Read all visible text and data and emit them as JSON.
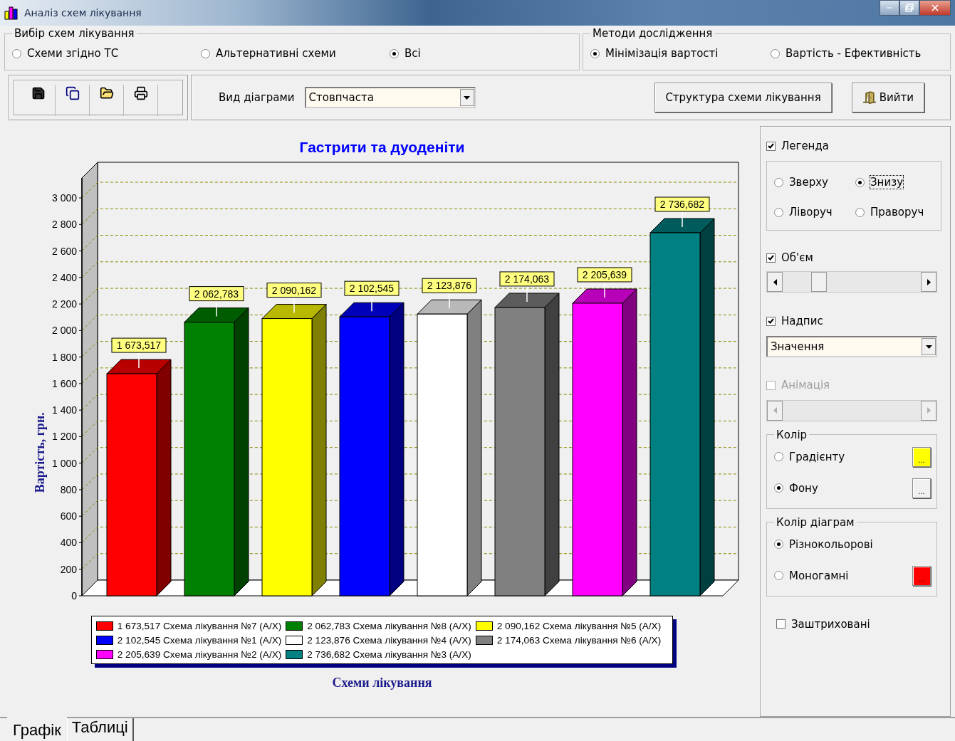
{
  "window": {
    "title": "Аналіз схем лікування"
  },
  "scheme_group": {
    "title": "Вибір схем лікування",
    "options": [
      {
        "label": "Схеми згідно ТС",
        "selected": false
      },
      {
        "label": "Альтернативні схеми",
        "selected": false
      },
      {
        "label": "Всі",
        "selected": true
      }
    ]
  },
  "method_group": {
    "title": "Методи дослідження",
    "options": [
      {
        "label": "Мінімізація вартості",
        "selected": true
      },
      {
        "label": "Вартість - Ефективність",
        "selected": false
      }
    ]
  },
  "toolbar": {
    "chart_type_label": "Вид діаграми",
    "chart_type_value": "Стовпчаста",
    "structure_button": "Структура схеми лікування",
    "exit_button": "Вийти"
  },
  "chart": {
    "chart_data": {
      "type": "bar",
      "title": "Гастрити та дуоденіти",
      "xlabel": "Схеми лікування",
      "ylabel": "Вартість, грн.",
      "series": [
        {
          "colors": [
            "#ff0000",
            "#008000",
            "#ffff00",
            "#0000ff",
            "#ffffff",
            "#808080",
            "#ff00ff",
            "#008080"
          ],
          "values": [
            1674,
            2063,
            2090,
            2103,
            2124,
            2174,
            2206,
            2737
          ]
        }
      ],
      "ylim": [
        0,
        3000
      ],
      "yticks": [
        {
          "value": 0,
          "label": "0"
        },
        {
          "value": 200,
          "label": "200"
        },
        {
          "value": 400,
          "label": "400"
        },
        {
          "value": 600,
          "label": "600"
        },
        {
          "value": 800,
          "label": "800"
        },
        {
          "value": 1000,
          "label": "1 000"
        },
        {
          "value": 1200,
          "label": "1 200"
        },
        {
          "value": 1400,
          "label": "1 400"
        },
        {
          "value": 1600,
          "label": "1 600"
        },
        {
          "value": 1800,
          "label": "1 800"
        },
        {
          "value": 2000,
          "label": "2 000"
        },
        {
          "value": 2200,
          "label": "2 200"
        },
        {
          "value": 2400,
          "label": "2 400"
        },
        {
          "value": 2600,
          "label": "2 600"
        },
        {
          "value": 2800,
          "label": "2 800"
        },
        {
          "value": 3000,
          "label": "3 000"
        }
      ],
      "value_labels": [
        "1 673,517",
        "2 062,783",
        "2 090,162",
        "2 102,545",
        "2 123,876",
        "2 174,063",
        "2 205,639",
        "2 736,682"
      ]
    },
    "legend": [
      {
        "value": "1 673,517",
        "name": "Схема лікування №7 (А/Х)",
        "color": "#ff0000"
      },
      {
        "value": "2 062,783",
        "name": "Схема лікування №8 (А/Х)",
        "color": "#008000"
      },
      {
        "value": "2 090,162",
        "name": "Схема лікування №5 (А/Х)",
        "color": "#ffff00"
      },
      {
        "value": "2 102,545",
        "name": "Схема лікування №1 (А/Х)",
        "color": "#0000ff"
      },
      {
        "value": "2 123,876",
        "name": "Схема лікування №4 (А/Х)",
        "color": "#ffffff"
      },
      {
        "value": "2 174,063",
        "name": "Схема лікування №6 (А/Х)",
        "color": "#808080"
      },
      {
        "value": "2 205,639",
        "name": "Схема лікування №2 (А/Х)",
        "color": "#ff00ff"
      },
      {
        "value": "2 736,682",
        "name": "Схема лікування №3 (А/Х)",
        "color": "#008080"
      }
    ]
  },
  "settings": {
    "legend_checkbox": {
      "label": "Легенда",
      "checked": true
    },
    "legend_position": [
      {
        "label": "Зверху",
        "selected": false
      },
      {
        "label": "Знизу",
        "selected": true
      },
      {
        "label": "Ліворуч",
        "selected": false
      },
      {
        "label": "Праворуч",
        "selected": false
      }
    ],
    "volume_checkbox": {
      "label": "Об'єм",
      "checked": true
    },
    "caption_checkbox": {
      "label": "Надпис",
      "checked": true
    },
    "caption_select": {
      "value": "Значення"
    },
    "animation_checkbox": {
      "label": "Анімація",
      "checked": false,
      "disabled": true
    },
    "color_group": {
      "title": "Колір",
      "options": [
        {
          "label": "Градієнту",
          "selected": false,
          "button": "...",
          "color": "#ffff00"
        },
        {
          "label": "Фону",
          "selected": true,
          "button": "...",
          "color": "#f0f0f0"
        }
      ]
    },
    "chart_color_group": {
      "title": "Колір діаграм",
      "options": [
        {
          "label": "Різнокольорові",
          "selected": true
        },
        {
          "label": "Моногамні",
          "selected": false,
          "button": "...",
          "color": "#ff0000"
        }
      ]
    },
    "hatched_checkbox": {
      "label": "Заштриховані",
      "checked": false
    }
  },
  "tabs": [
    {
      "label": "Графік",
      "selected": true
    },
    {
      "label": "Таблиці",
      "selected": false
    }
  ]
}
